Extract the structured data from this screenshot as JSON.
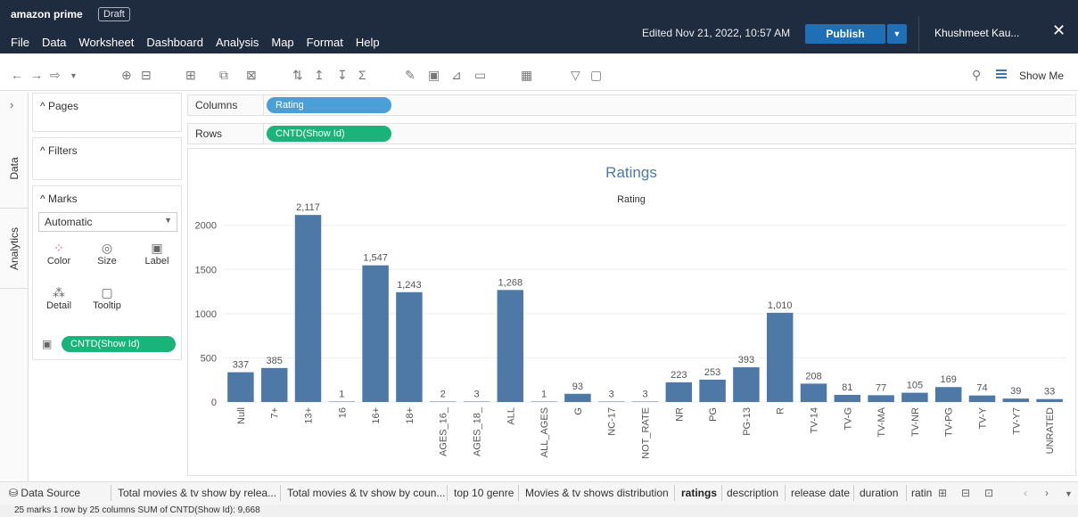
{
  "app": {
    "title": "amazon prime",
    "badge": "Draft"
  },
  "menu": [
    "File",
    "Data",
    "Worksheet",
    "Dashboard",
    "Analysis",
    "Map",
    "Format",
    "Help"
  ],
  "header": {
    "edited": "Edited Nov 21, 2022, 10:57 AM",
    "publish_label": "Publish",
    "user": "Khushmeet Kau...",
    "close_glyph": "✕"
  },
  "toolbar": {
    "show_me_label": "Show Me"
  },
  "sidebar": {
    "data_tab": "Data",
    "analytics_tab": "Analytics"
  },
  "cards": {
    "pages_title": "^ Pages",
    "filters_title": "^ Filters",
    "marks_title": "^ Marks",
    "mark_type": "Automatic",
    "buttons": [
      "Color",
      "Size",
      "Label",
      "Detail",
      "Tooltip"
    ],
    "marks_pill": "CNTD(Show Id)"
  },
  "shelves": {
    "columns_label": "Columns",
    "columns_pill": "Rating",
    "rows_label": "Rows",
    "rows_pill": "CNTD(Show Id)"
  },
  "tabs": [
    "Data Source",
    "Total movies & tv show by relea...",
    "Total movies & tv show by coun...",
    "top 10 genre",
    "Movies & tv shows distribution",
    "ratings",
    "description",
    "release date",
    "duration",
    "ratin"
  ],
  "active_tab_index": 5,
  "status_bar": "25 marks   1 row by 25 columns   SUM of CNTD(Show Id): 9,668",
  "chart_data": {
    "type": "bar",
    "title": "Ratings",
    "subtitle": "Rating",
    "xlabel": "",
    "ylabel": "",
    "ylim": [
      0,
      2300
    ],
    "yticks": [
      0,
      500,
      1000,
      1500,
      2000
    ],
    "bar_color": "#4e79a7",
    "categories": [
      "Null",
      "7+",
      "13+",
      "16",
      "16+",
      "18+",
      "AGES_16_",
      "AGES_18_",
      "ALL",
      "ALL_AGES",
      "G",
      "NC-17",
      "NOT_RATE",
      "NR",
      "PG",
      "PG-13",
      "R",
      "TV-14",
      "TV-G",
      "TV-MA",
      "TV-NR",
      "TV-PG",
      "TV-Y",
      "TV-Y7",
      "UNRATED"
    ],
    "values": [
      337,
      385,
      2117,
      1,
      1547,
      1243,
      2,
      3,
      1268,
      1,
      93,
      3,
      3,
      223,
      253,
      393,
      1010,
      208,
      81,
      77,
      105,
      169,
      74,
      39,
      33
    ],
    "labels": [
      "337",
      "385",
      "2,117",
      "1",
      "1,547",
      "1,243",
      "2",
      "3",
      "1,268",
      "1",
      "93",
      "3",
      "3",
      "223",
      "253",
      "393",
      "1,010",
      "208",
      "81",
      "77",
      "105",
      "169",
      "74",
      "39",
      "33"
    ],
    "grid": true
  }
}
